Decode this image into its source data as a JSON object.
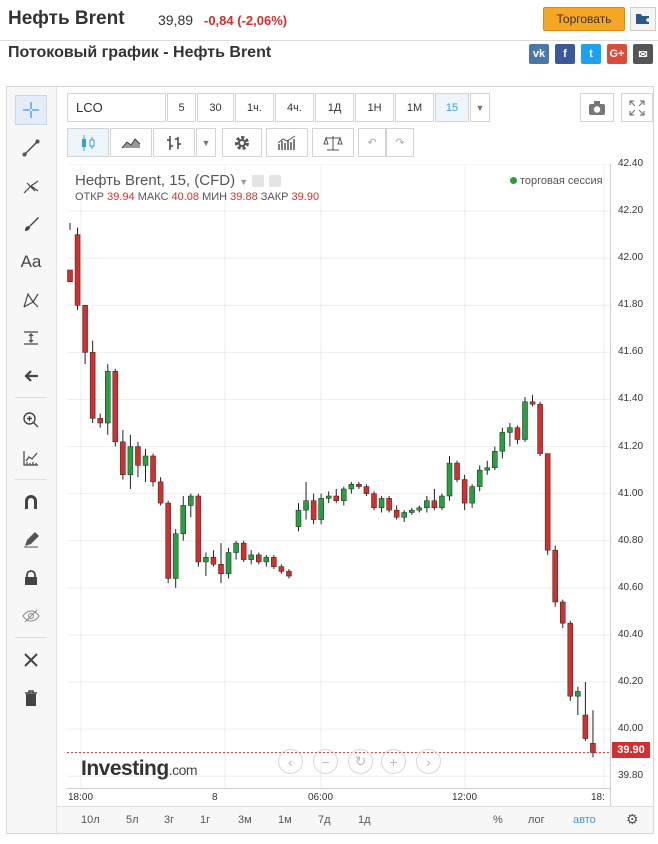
{
  "header": {
    "instrument": "Нефть Brent",
    "last_price": "39,89",
    "change": "-0,84 (-2,06%)",
    "trade_label": "Торговать",
    "page_title": "Потоковый график - Нефть Brent"
  },
  "share": [
    {
      "name": "vk",
      "label": "vk",
      "color": "#4a76a8"
    },
    {
      "name": "facebook",
      "label": "f",
      "color": "#3b5998"
    },
    {
      "name": "twitter",
      "label": "t",
      "color": "#1da1f2"
    },
    {
      "name": "google-plus",
      "label": "G+",
      "color": "#dd4b39"
    },
    {
      "name": "email",
      "label": "✉",
      "color": "#555555"
    }
  ],
  "toolbar": {
    "symbol": "LCO",
    "intervals": [
      "5",
      "30",
      "1ч.",
      "4ч.",
      "1Д",
      "1Н",
      "1М",
      "15"
    ],
    "selected_interval": "15"
  },
  "legend": {
    "title": "Нефть Brent, 15, (CFD)",
    "open_label": "ОТКР",
    "open": "39.94",
    "high_label": "МАКС",
    "high": "40.08",
    "low_label": "МИН",
    "low": "39.88",
    "close_label": "ЗАКР",
    "close": "39.90",
    "session": "торговая сессия"
  },
  "current_price": "39.90",
  "ranges": [
    "10л",
    "5л",
    "3г",
    "1г",
    "3м",
    "1м",
    "7д",
    "1д"
  ],
  "scale_options": [
    "%",
    "лог",
    "авто"
  ],
  "selected_scale": "авто",
  "watermark": {
    "brand": "Investing",
    "suffix": ".com"
  },
  "colors": {
    "up": "#26a040",
    "down": "#d32f2f",
    "accent": "#3b9cd9"
  },
  "chart_data": {
    "type": "candlestick",
    "y_ticks": [
      "42.40",
      "42.20",
      "42.00",
      "41.80",
      "41.60",
      "41.40",
      "41.20",
      "41.00",
      "40.80",
      "40.60",
      "40.40",
      "40.20",
      "40.00",
      "39.80"
    ],
    "x_ticks": [
      "18:00",
      "8",
      "06:00",
      "12:00",
      "18:"
    ],
    "ylim": [
      39.75,
      42.4
    ],
    "candles": [
      [
        41.95,
        42.15,
        42.12,
        41.9
      ],
      [
        42.1,
        42.13,
        41.78,
        41.8
      ],
      [
        41.8,
        41.8,
        41.55,
        41.6
      ],
      [
        41.6,
        41.65,
        41.3,
        41.32
      ],
      [
        41.32,
        41.34,
        41.28,
        41.3
      ],
      [
        41.3,
        41.55,
        41.25,
        41.52
      ],
      [
        41.52,
        41.53,
        41.2,
        41.22
      ],
      [
        41.22,
        41.27,
        41.06,
        41.08
      ],
      [
        41.08,
        41.25,
        41.02,
        41.2
      ],
      [
        41.2,
        41.22,
        41.07,
        41.12
      ],
      [
        41.12,
        41.19,
        41.05,
        41.16
      ],
      [
        41.16,
        41.17,
        41.03,
        41.05
      ],
      [
        41.05,
        41.07,
        40.95,
        40.96
      ],
      [
        40.96,
        40.97,
        40.62,
        40.64
      ],
      [
        40.64,
        40.85,
        40.6,
        40.83
      ],
      [
        40.83,
        40.99,
        40.8,
        40.95
      ],
      [
        40.95,
        41.0,
        40.9,
        40.99
      ],
      [
        40.99,
        41.0,
        40.69,
        40.71
      ],
      [
        40.71,
        40.75,
        40.65,
        40.73
      ],
      [
        40.73,
        40.76,
        40.69,
        40.7
      ],
      [
        40.7,
        40.79,
        40.62,
        40.66
      ],
      [
        40.66,
        40.77,
        40.64,
        40.75
      ],
      [
        40.75,
        40.8,
        40.72,
        40.79
      ],
      [
        40.79,
        40.8,
        40.71,
        40.72
      ],
      [
        40.72,
        40.76,
        40.7,
        40.74
      ],
      [
        40.74,
        40.75,
        40.7,
        40.71
      ],
      [
        40.71,
        40.74,
        40.69,
        40.73
      ],
      [
        40.73,
        40.74,
        40.68,
        40.69
      ],
      [
        40.69,
        40.7,
        40.66,
        40.67
      ],
      [
        40.67,
        40.68,
        40.64,
        40.65
      ],
      [
        40.86,
        40.96,
        40.84,
        40.93
      ],
      [
        40.93,
        41.05,
        40.89,
        40.97
      ],
      [
        40.97,
        41.0,
        40.87,
        40.89
      ],
      [
        40.89,
        41.0,
        40.87,
        40.98
      ],
      [
        40.98,
        41.01,
        40.96,
        40.99
      ],
      [
        40.99,
        41.02,
        40.96,
        40.97
      ],
      [
        40.97,
        41.03,
        40.95,
        41.02
      ],
      [
        41.02,
        41.05,
        41.0,
        41.04
      ],
      [
        41.04,
        41.05,
        41.02,
        41.03
      ],
      [
        41.03,
        41.04,
        40.99,
        41.0
      ],
      [
        41.0,
        41.01,
        40.93,
        40.94
      ],
      [
        40.94,
        40.99,
        40.92,
        40.98
      ],
      [
        40.98,
        40.99,
        40.92,
        40.93
      ],
      [
        40.93,
        40.95,
        40.89,
        40.9
      ],
      [
        40.9,
        40.93,
        40.88,
        40.92
      ],
      [
        40.92,
        40.94,
        40.91,
        40.93
      ],
      [
        40.93,
        40.95,
        40.92,
        40.94
      ],
      [
        40.94,
        40.99,
        40.92,
        40.97
      ],
      [
        40.97,
        41.02,
        40.93,
        40.94
      ],
      [
        40.94,
        41.0,
        40.93,
        40.99
      ],
      [
        40.99,
        41.16,
        40.97,
        41.13
      ],
      [
        41.13,
        41.14,
        41.05,
        41.06
      ],
      [
        41.06,
        41.08,
        40.93,
        40.96
      ],
      [
        40.96,
        41.04,
        40.94,
        41.03
      ],
      [
        41.03,
        41.12,
        41.01,
        41.1
      ],
      [
        41.1,
        41.14,
        41.08,
        41.11
      ],
      [
        41.11,
        41.2,
        41.1,
        41.18
      ],
      [
        41.18,
        41.28,
        41.15,
        41.26
      ],
      [
        41.26,
        41.3,
        41.2,
        41.28
      ],
      [
        41.28,
        41.29,
        41.21,
        41.23
      ],
      [
        41.23,
        41.41,
        41.22,
        41.39
      ],
      [
        41.39,
        41.42,
        41.37,
        41.38
      ],
      [
        41.38,
        41.39,
        41.16,
        41.17
      ],
      [
        41.17,
        41.17,
        40.74,
        40.76
      ],
      [
        40.76,
        40.78,
        40.52,
        40.54
      ],
      [
        40.54,
        40.55,
        40.43,
        40.45
      ],
      [
        40.45,
        40.46,
        40.12,
        40.14
      ],
      [
        40.14,
        40.18,
        40.06,
        40.16
      ],
      [
        40.06,
        40.2,
        39.95,
        39.96
      ],
      [
        39.94,
        40.08,
        39.88,
        39.9
      ]
    ]
  }
}
